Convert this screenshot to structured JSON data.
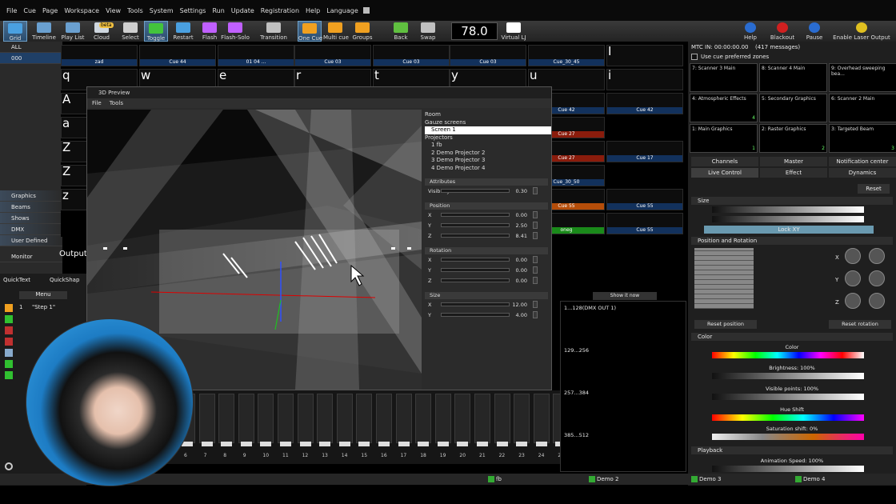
{
  "menu": [
    "File",
    "Cue",
    "Page",
    "Workspace",
    "View",
    "Tools",
    "System",
    "Settings",
    "Run",
    "Update",
    "Registration",
    "Help",
    "Language"
  ],
  "toolbar": [
    {
      "label": "Grid",
      "icon": "grid-icon",
      "color": "#4aa0e0"
    },
    {
      "label": "Timeline",
      "icon": "timeline-icon",
      "color": "#6aa0d0"
    },
    {
      "label": "Play List",
      "icon": "playlist-icon",
      "color": "#6aa0d0"
    },
    {
      "label": "Cloud",
      "icon": "cloud-icon",
      "color": "#cfd7df"
    },
    {
      "label": "Select",
      "icon": "select-icon",
      "color": "#cfcfcf"
    },
    {
      "label": "Toggle",
      "icon": "toggle-icon",
      "color": "#43c43c"
    },
    {
      "label": "Restart",
      "icon": "restart-icon",
      "color": "#4aa0e0"
    },
    {
      "label": "Flash",
      "icon": "flash-icon",
      "color": "#c060ff"
    },
    {
      "label": "Flash-Solo",
      "icon": "flash-solo-icon",
      "color": "#c060ff"
    },
    {
      "label": "Transition",
      "icon": "transition-icon",
      "color": "#c0c0c0"
    },
    {
      "label": "One Cue",
      "icon": "one-cue-icon",
      "color": "#f0a020"
    },
    {
      "label": "Multi cue",
      "icon": "multi-cue-icon",
      "color": "#f0a020"
    },
    {
      "label": "Groups",
      "icon": "groups-icon",
      "color": "#f0a020"
    },
    {
      "label": "Back",
      "icon": "back-icon",
      "color": "#60c040"
    },
    {
      "label": "Swap",
      "icon": "swap-icon",
      "color": "#c0c0c0"
    },
    {
      "label": "Virtual LJ",
      "icon": "virtual-lj-icon",
      "color": "#ffffff"
    }
  ],
  "bpm": "78.0",
  "right_toolbar": [
    {
      "label": "Help"
    },
    {
      "label": "Blackout"
    },
    {
      "label": "Pause"
    },
    {
      "label": "Enable Laser Output"
    }
  ],
  "cloud_badge": "beta",
  "pages_top": [
    "ALL",
    "000"
  ],
  "pages_bottom": [
    "Graphics",
    "Beams",
    "Shows",
    "DMX",
    "User Defined"
  ],
  "monitor_label": "Monitor",
  "output_label": "Output",
  "quicktext": "QuickText",
  "quickshape": "QuickShap",
  "menu_label": "Menu",
  "step_label": "\"Step 1\"",
  "step_num": "1",
  "grid_keys": [
    "Q",
    "W",
    "E",
    "R",
    "T",
    "Y",
    "U",
    "I",
    "q",
    "w",
    "e",
    "r",
    "t",
    "y",
    "u",
    "i",
    "A",
    "a",
    "Z",
    "Z",
    "z"
  ],
  "grid_caps": [
    {
      "text": "zad",
      "color": "teal"
    },
    {
      "text": "Cue 44"
    },
    {
      "text": "01 04 ..."
    },
    {
      "text": "Cue 03"
    },
    {
      "text": "Cue 03"
    },
    {
      "text": "Cue 03"
    },
    {
      "text": "Cue_30_45"
    },
    {
      "text": "Cue 42"
    },
    {
      "text": "Cue 42"
    },
    {
      "text": "Cue 27"
    },
    {
      "text": "Cue 27"
    },
    {
      "text": "Cue 17"
    },
    {
      "text": "Cue_30_50"
    },
    {
      "text": "Cue 55"
    },
    {
      "text": "Cue 55"
    },
    {
      "text": "oneg"
    },
    {
      "text": "Cue 55"
    }
  ],
  "mtc": "MTC IN: 00:00:00.00",
  "messages": "(417 messages)",
  "preferred_zones": "Use cue preferred zones",
  "monitors": [
    {
      "label": "7: Scanner 3 Main"
    },
    {
      "label": "8: Scanner 4 Main"
    },
    {
      "label": "9: Overhead sweeping bea..."
    },
    {
      "label": "4: Atmospheric Effects",
      "num": "4"
    },
    {
      "label": "5: Secondary Graphics"
    },
    {
      "label": "6: Scanner 2 Main"
    },
    {
      "label": "1: Main Graphics",
      "num": "1"
    },
    {
      "label": "2: Raster Graphics",
      "num": "2"
    },
    {
      "label": "3: Targeted Beam",
      "num": "3"
    }
  ],
  "right_tabs": [
    "Channels",
    "Master",
    "Notification center"
  ],
  "right_tabs2": [
    "Live Control",
    "Effect",
    "Dynamics"
  ],
  "reset_label": "Reset",
  "size_section": "Size",
  "lock_label": "Lock XY",
  "pos_rot_section": "Position and Rotation",
  "reset_position": "Reset position",
  "reset_rotation": "Reset rotation",
  "axis_labels": [
    "X",
    "Y",
    "Z"
  ],
  "color_section": "Color",
  "color_label": "Color",
  "brightness": "Brightness: 100%",
  "visible_points": "Visible points: 100%",
  "hue_shift": "Hue Shift",
  "saturation": "Saturation shift: 0%",
  "playback_section": "Playback",
  "anim_speed": "Animation Speed: 100%",
  "show_it_now": "Show it now",
  "dmx_rows": [
    "1...128(DMX OUT 1)",
    "129...256",
    "257...384",
    "385...512"
  ],
  "fader_nums": [
    "6",
    "7",
    "8",
    "9",
    "10",
    "11",
    "12",
    "13",
    "14",
    "15",
    "16",
    "17",
    "18",
    "19",
    "20",
    "21",
    "22",
    "23",
    "24",
    "25"
  ],
  "fader_levels": [
    0,
    0,
    0,
    0,
    0,
    0,
    0,
    0,
    0,
    0,
    0,
    0,
    0,
    0,
    0,
    0,
    0,
    0,
    0,
    0
  ],
  "preview": {
    "title": "3D Preview",
    "menu": [
      "File",
      "Tools"
    ],
    "tree": [
      {
        "text": "Room",
        "indent": 0
      },
      {
        "text": "Gauze screens",
        "indent": 0
      },
      {
        "text": "Screen 1",
        "indent": 1,
        "sel": true
      },
      {
        "text": "Projectors",
        "indent": 0
      },
      {
        "text": "1 fb",
        "indent": 1
      },
      {
        "text": "2 Demo Projector 2",
        "indent": 1
      },
      {
        "text": "3 Demo Projector 3",
        "indent": 1
      },
      {
        "text": "4 Demo Projector 4",
        "indent": 1
      }
    ],
    "attributes_label": "Attributes",
    "visibility_label": "Visibility",
    "visibility": "0.30",
    "position_label": "Position",
    "position": [
      {
        "axis": "X",
        "value": "0.00"
      },
      {
        "axis": "Y",
        "value": "2.50"
      },
      {
        "axis": "Z",
        "value": "8.41"
      }
    ],
    "rotation_label": "Rotation",
    "rotation": [
      {
        "axis": "X",
        "value": "0.00"
      },
      {
        "axis": "Y",
        "value": "0.00"
      },
      {
        "axis": "Z",
        "value": "0.00"
      }
    ],
    "size_label": "Size",
    "size": [
      {
        "axis": "X",
        "value": "12.00"
      },
      {
        "axis": "Y",
        "value": "4.00"
      }
    ]
  },
  "bottom": {
    "items": [
      "fb",
      "Demo 2",
      "Demo 3",
      "Demo 4"
    ]
  }
}
